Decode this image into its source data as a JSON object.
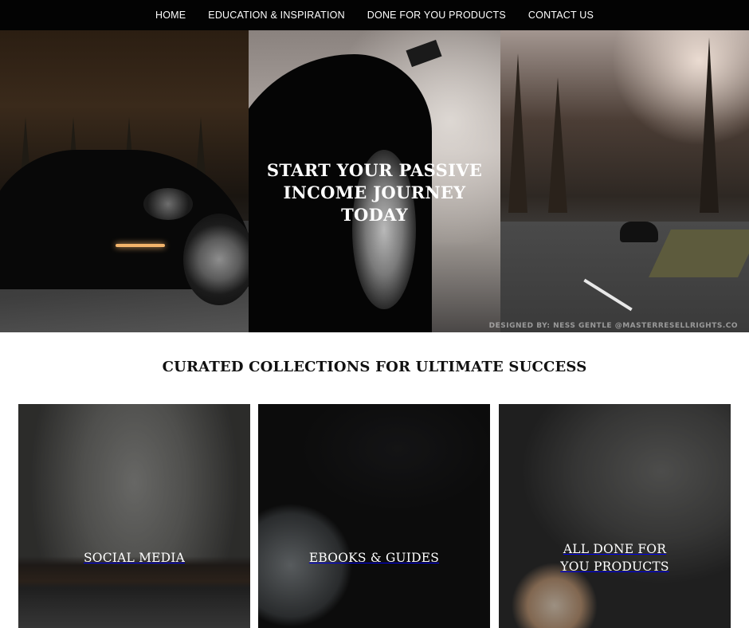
{
  "nav": {
    "items": [
      {
        "label": "HOME"
      },
      {
        "label": "EDUCATION & INSPIRATION"
      },
      {
        "label": "DONE FOR YOU PRODUCTS"
      },
      {
        "label": "CONTACT US"
      }
    ]
  },
  "hero": {
    "title": "START YOUR PASSIVE INCOME JOURNEY TODAY",
    "credit": "DESIGNED BY: NESS GENTLE @MASTERRESELLRIGHTS.CO"
  },
  "collections": {
    "title": "CURATED COLLECTIONS FOR ULTIMATE SUCCESS",
    "cards": [
      {
        "label": "SOCIAL MEDIA"
      },
      {
        "label": "EBOOKS & GUIDES"
      },
      {
        "label": "ALL DONE FOR YOU PRODUCTS"
      }
    ]
  },
  "colors": {
    "nav_background": "#030303",
    "nav_text": "#ffffff",
    "page_background": "#ffffff",
    "heading_text": "#111111"
  }
}
